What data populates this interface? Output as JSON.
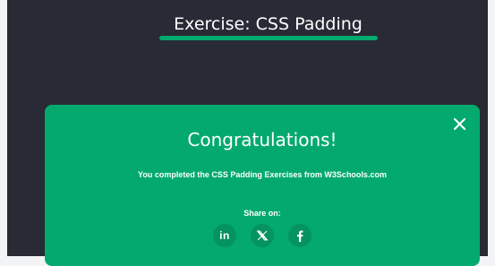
{
  "header": {
    "title": "Exercise: CSS Padding"
  },
  "modal": {
    "heading": "Congratulations!",
    "message": "You completed the CSS Padding Exercises from W3Schools.com",
    "share_label": "Share on:",
    "close_icon": "close-icon",
    "share_buttons": [
      {
        "name": "linkedin",
        "icon": "linkedin-icon",
        "glyph": "in"
      },
      {
        "name": "x",
        "icon": "x-icon"
      },
      {
        "name": "facebook",
        "icon": "facebook-icon"
      }
    ]
  },
  "colors": {
    "page_background": "#282a35",
    "accent_green": "#04aa6d",
    "button_green": "#05935f",
    "text": "#ffffff"
  }
}
